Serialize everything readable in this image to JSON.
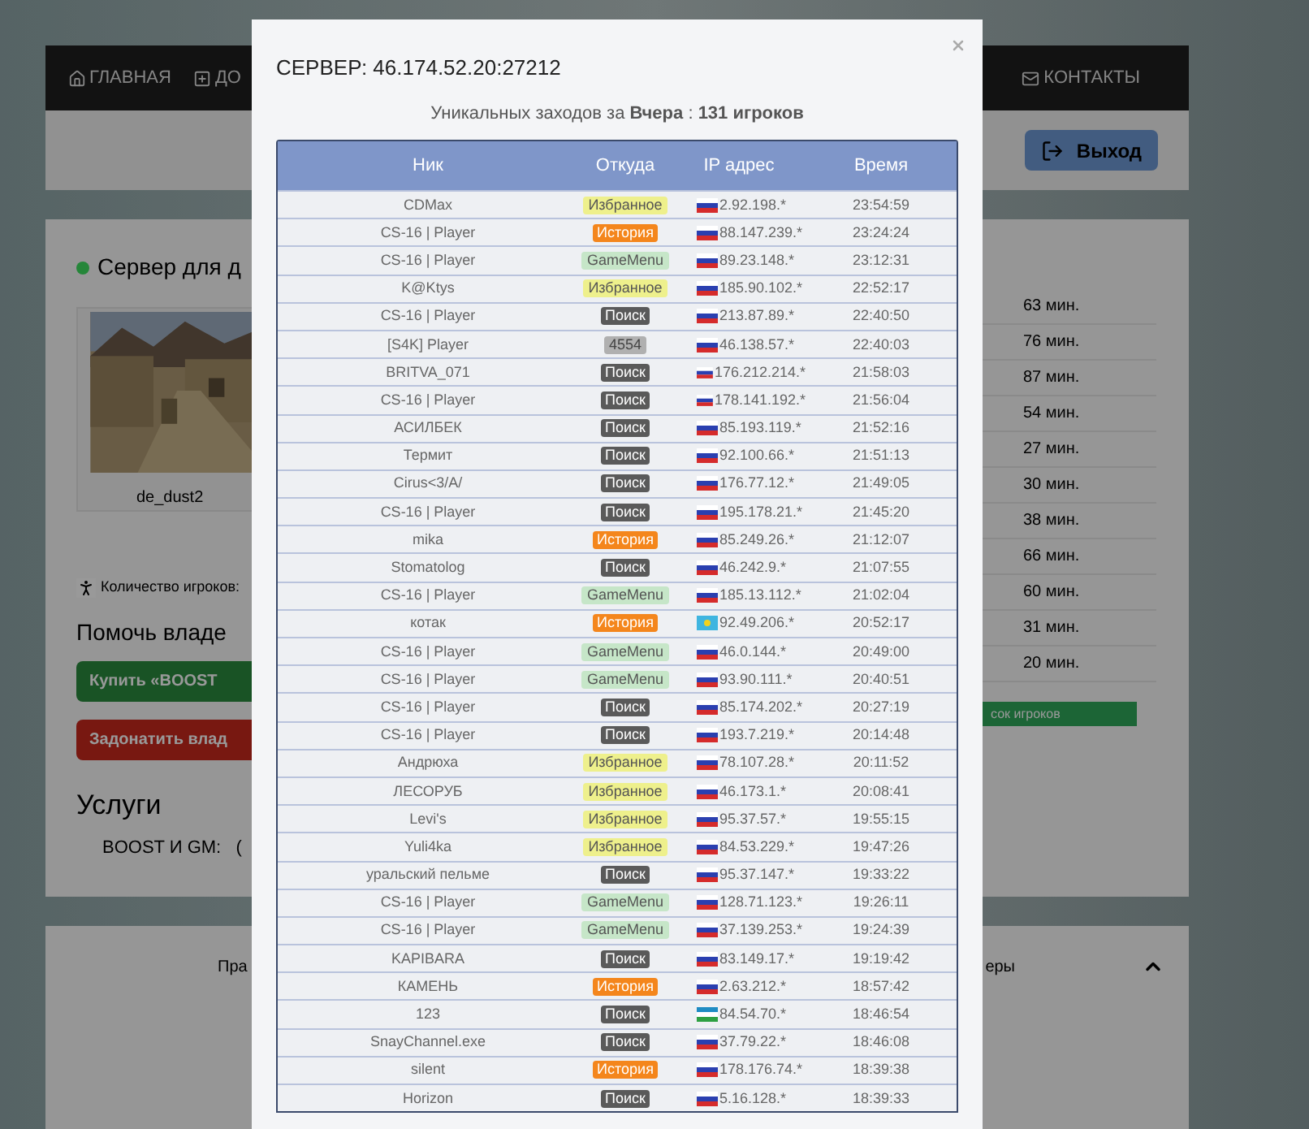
{
  "nav": {
    "items": [
      {
        "label": "ГЛАВНАЯ",
        "kind": "home"
      },
      {
        "label": "ДО",
        "kind": "add"
      }
    ],
    "contacts": {
      "label": "КОНТАКТЫ"
    }
  },
  "toolbar": {
    "logout": "Выход"
  },
  "server": {
    "title": "Сервер для д",
    "online": true,
    "map_caption": "de_dust2",
    "players_label": "Количество игроков:",
    "help_title": "Помочь владе",
    "buy_button": "Купить «BOOST",
    "donate_button": "Задонатить влад",
    "services_title": "Услуги",
    "services_text": "BOOST И GM:   (",
    "minutes": [
      "63 мин.",
      "76 мин.",
      "87 мин.",
      "54 мин.",
      "27 мин.",
      "30 мин.",
      "38 мин.",
      "66 мин.",
      "60 мин.",
      "31 мин.",
      "20 мин."
    ],
    "players_list_button": "сок игроков"
  },
  "footer": {
    "left_text": "Пра",
    "right_text": "еры"
  },
  "modal": {
    "title": "СЕРВЕР: 46.174.52.20:27212",
    "summary": "Уникальных заходов за **Вчера** : **131 игроков**",
    "columns": [
      "Ник",
      "Откуда",
      "IP адрес",
      "Время"
    ],
    "rows": [
      {
        "nick": "CDMax",
        "source": {
          "label": "Избранное",
          "kind": "favorite"
        },
        "flag": {
          "kind": "ru"
        },
        "ip": "2.92.198.*",
        "time": "23:54:59"
      },
      {
        "nick": "CS-16 | Player",
        "source": {
          "label": "История",
          "kind": "history"
        },
        "flag": {
          "kind": "ru"
        },
        "ip": "88.147.239.*",
        "time": "23:24:24"
      },
      {
        "nick": "CS-16 | Player",
        "source": {
          "label": "GameMenu",
          "kind": "gamemenu"
        },
        "flag": {
          "kind": "ru"
        },
        "ip": "89.23.148.*",
        "time": "23:12:31"
      },
      {
        "nick": "K@Ktys",
        "source": {
          "label": "Избранное",
          "kind": "favorite"
        },
        "flag": {
          "kind": "ru"
        },
        "ip": "185.90.102.*",
        "time": "22:52:17"
      },
      {
        "nick": "CS-16 | Player",
        "source": {
          "label": "Поиск",
          "kind": "search"
        },
        "flag": {
          "kind": "ru"
        },
        "ip": "213.87.89.*",
        "time": "22:40:50"
      },
      {
        "nick": "[S4K] Player",
        "source": {
          "label": "4554",
          "kind": "port"
        },
        "flag": {
          "kind": "ru"
        },
        "ip": "46.138.57.*",
        "time": "22:40:03"
      },
      {
        "nick": "BRITVA_071",
        "source": {
          "label": "Поиск",
          "kind": "search"
        },
        "flag": {
          "kind": "ru"
        },
        "ip": "176.212.214.*",
        "time": "21:58:03"
      },
      {
        "nick": "CS-16 | Player",
        "source": {
          "label": "Поиск",
          "kind": "search"
        },
        "flag": {
          "kind": "ru"
        },
        "ip": "178.141.192.*",
        "time": "21:56:04"
      },
      {
        "nick": "АСИЛБЕК",
        "source": {
          "label": "Поиск",
          "kind": "search"
        },
        "flag": {
          "kind": "ru"
        },
        "ip": "85.193.119.*",
        "time": "21:52:16"
      },
      {
        "nick": "Термит",
        "source": {
          "label": "Поиск",
          "kind": "search"
        },
        "flag": {
          "kind": "ru"
        },
        "ip": "92.100.66.*",
        "time": "21:51:13"
      },
      {
        "nick": "Cirus<3/A/",
        "source": {
          "label": "Поиск",
          "kind": "search"
        },
        "flag": {
          "kind": "ru"
        },
        "ip": "176.77.12.*",
        "time": "21:49:05"
      },
      {
        "nick": "CS-16 | Player",
        "source": {
          "label": "Поиск",
          "kind": "search"
        },
        "flag": {
          "kind": "ru"
        },
        "ip": "195.178.21.*",
        "time": "21:45:20"
      },
      {
        "nick": "mika",
        "source": {
          "label": "История",
          "kind": "history"
        },
        "flag": {
          "kind": "ru"
        },
        "ip": "85.249.26.*",
        "time": "21:12:07"
      },
      {
        "nick": "Stomatolog",
        "source": {
          "label": "Поиск",
          "kind": "search"
        },
        "flag": {
          "kind": "ru"
        },
        "ip": "46.242.9.*",
        "time": "21:07:55"
      },
      {
        "nick": "CS-16 | Player",
        "source": {
          "label": "GameMenu",
          "kind": "gamemenu"
        },
        "flag": {
          "kind": "ru"
        },
        "ip": "185.13.112.*",
        "time": "21:02:04"
      },
      {
        "nick": "котак",
        "source": {
          "label": "История",
          "kind": "history"
        },
        "flag": {
          "kind": "kz"
        },
        "ip": "92.49.206.*",
        "time": "20:52:17"
      },
      {
        "nick": "CS-16 | Player",
        "source": {
          "label": "GameMenu",
          "kind": "gamemenu"
        },
        "flag": {
          "kind": "ru"
        },
        "ip": "46.0.144.*",
        "time": "20:49:00"
      },
      {
        "nick": "CS-16 | Player",
        "source": {
          "label": "GameMenu",
          "kind": "gamemenu"
        },
        "flag": {
          "kind": "ru"
        },
        "ip": "93.90.111.*",
        "time": "20:40:51"
      },
      {
        "nick": "CS-16 | Player",
        "source": {
          "label": "Поиск",
          "kind": "search"
        },
        "flag": {
          "kind": "ru"
        },
        "ip": "85.174.202.*",
        "time": "20:27:19"
      },
      {
        "nick": "CS-16 | Player",
        "source": {
          "label": "Поиск",
          "kind": "search"
        },
        "flag": {
          "kind": "ru"
        },
        "ip": "193.7.219.*",
        "time": "20:14:48"
      },
      {
        "nick": "Андрюха",
        "source": {
          "label": "Избранное",
          "kind": "favorite"
        },
        "flag": {
          "kind": "ru"
        },
        "ip": "78.107.28.*",
        "time": "20:11:52"
      },
      {
        "nick": "ЛЕСОРУБ",
        "source": {
          "label": "Избранное",
          "kind": "favorite"
        },
        "flag": {
          "kind": "ru"
        },
        "ip": "46.173.1.*",
        "time": "20:08:41"
      },
      {
        "nick": "Levi's",
        "source": {
          "label": "Избранное",
          "kind": "favorite"
        },
        "flag": {
          "kind": "ru"
        },
        "ip": "95.37.57.*",
        "time": "19:55:15"
      },
      {
        "nick": "Yuli4ka",
        "source": {
          "label": "Избранное",
          "kind": "favorite"
        },
        "flag": {
          "kind": "ru"
        },
        "ip": "84.53.229.*",
        "time": "19:47:26"
      },
      {
        "nick": "уральский пельме",
        "source": {
          "label": "Поиск",
          "kind": "search"
        },
        "flag": {
          "kind": "ru"
        },
        "ip": "95.37.147.*",
        "time": "19:33:22"
      },
      {
        "nick": "CS-16 | Player",
        "source": {
          "label": "GameMenu",
          "kind": "gamemenu"
        },
        "flag": {
          "kind": "ru"
        },
        "ip": "128.71.123.*",
        "time": "19:26:11"
      },
      {
        "nick": "CS-16 | Player",
        "source": {
          "label": "GameMenu",
          "kind": "gamemenu"
        },
        "flag": {
          "kind": "ru"
        },
        "ip": "37.139.253.*",
        "time": "19:24:39"
      },
      {
        "nick": "KAPIBARA",
        "source": {
          "label": "Поиск",
          "kind": "search"
        },
        "flag": {
          "kind": "ru"
        },
        "ip": "83.149.17.*",
        "time": "19:19:42"
      },
      {
        "nick": "КАМЕНЬ",
        "source": {
          "label": "История",
          "kind": "history"
        },
        "flag": {
          "kind": "ru"
        },
        "ip": "2.63.212.*",
        "time": "18:57:42"
      },
      {
        "nick": "123",
        "source": {
          "label": "Поиск",
          "kind": "search"
        },
        "flag": {
          "kind": "uz"
        },
        "ip": "84.54.70.*",
        "time": "18:46:54"
      },
      {
        "nick": "SnayChannel.exe",
        "source": {
          "label": "Поиск",
          "kind": "search"
        },
        "flag": {
          "kind": "ru"
        },
        "ip": "37.79.22.*",
        "time": "18:46:08"
      },
      {
        "nick": "silent",
        "source": {
          "label": "История",
          "kind": "history"
        },
        "flag": {
          "kind": "ru"
        },
        "ip": "178.176.74.*",
        "time": "18:39:38"
      },
      {
        "nick": "Horizon",
        "source": {
          "label": "Поиск",
          "kind": "search"
        },
        "flag": {
          "kind": "ru"
        },
        "ip": "5.16.128.*",
        "time": "18:39:33"
      }
    ]
  }
}
